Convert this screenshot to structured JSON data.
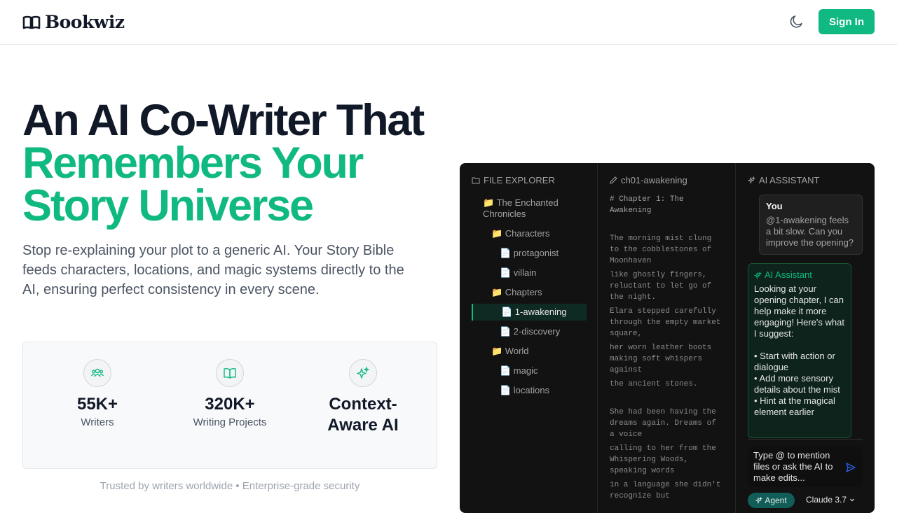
{
  "header": {
    "brand": "Bookwiz",
    "sign_in": "Sign In"
  },
  "hero": {
    "title_line1": "An AI Co-Writer That",
    "title_line2": "Remembers Your",
    "title_line3": "Story Universe",
    "subtitle": "Stop re-explaining your plot to a generic AI. Your Story Bible feeds characters, locations, and magic systems directly to the AI, ensuring perfect consistency in every scene."
  },
  "stats": [
    {
      "value": "55K+",
      "label": "Writers",
      "icon": "users-icon"
    },
    {
      "value": "320K+",
      "label": "Writing Projects",
      "icon": "book-open-icon"
    },
    {
      "value": "Context-Aware AI",
      "icon": "sparkles-icon"
    }
  ],
  "trusted": "Trusted by writers worldwide • Enterprise-grade security",
  "editor": {
    "explorer_title": "FILE EXPLORER",
    "tree": [
      {
        "label": "📁 The Enchanted Chronicles"
      },
      {
        "label": "📁 Characters"
      },
      {
        "label": "📄 protagonist"
      },
      {
        "label": "📄 villain"
      },
      {
        "label": "📁 Chapters"
      },
      {
        "label": "📄 1-awakening",
        "active": true
      },
      {
        "label": "📄 2-discovery"
      },
      {
        "label": "📁 World"
      },
      {
        "label": "📄 magic"
      },
      {
        "label": "📄 locations"
      }
    ],
    "doc_title": "ch01-awakening",
    "doc_lines": [
      "# Chapter 1: The Awakening",
      "The morning mist clung to the cobblestones of Moonhaven",
      "like ghostly fingers, reluctant to let go of the night.",
      "Elara stepped carefully through the empty market square,",
      "her worn leather boots making soft whispers against",
      "the ancient stones.",
      "She had been having the dreams again. Dreams of a voice",
      "calling to her from the Whispering Woods, speaking words",
      "in a language she didn't recognize but"
    ],
    "assistant_title": "AI ASSISTANT",
    "user_name": "You",
    "user_message": "@1-awakening feels a bit slow. Can you improve the opening?",
    "ai_name": "AI Assistant",
    "ai_message": "Looking at your opening chapter, I can help make it more engaging! Here's what I suggest:",
    "ai_bullets": [
      "• Start with action or dialogue",
      "• Add more sensory details about the mist",
      "• Hint at the magical element earlier"
    ],
    "input_placeholder": "Type @ to mention files or ask the AI to make edits...",
    "mode": "Agent",
    "model": "Claude 3.7"
  }
}
